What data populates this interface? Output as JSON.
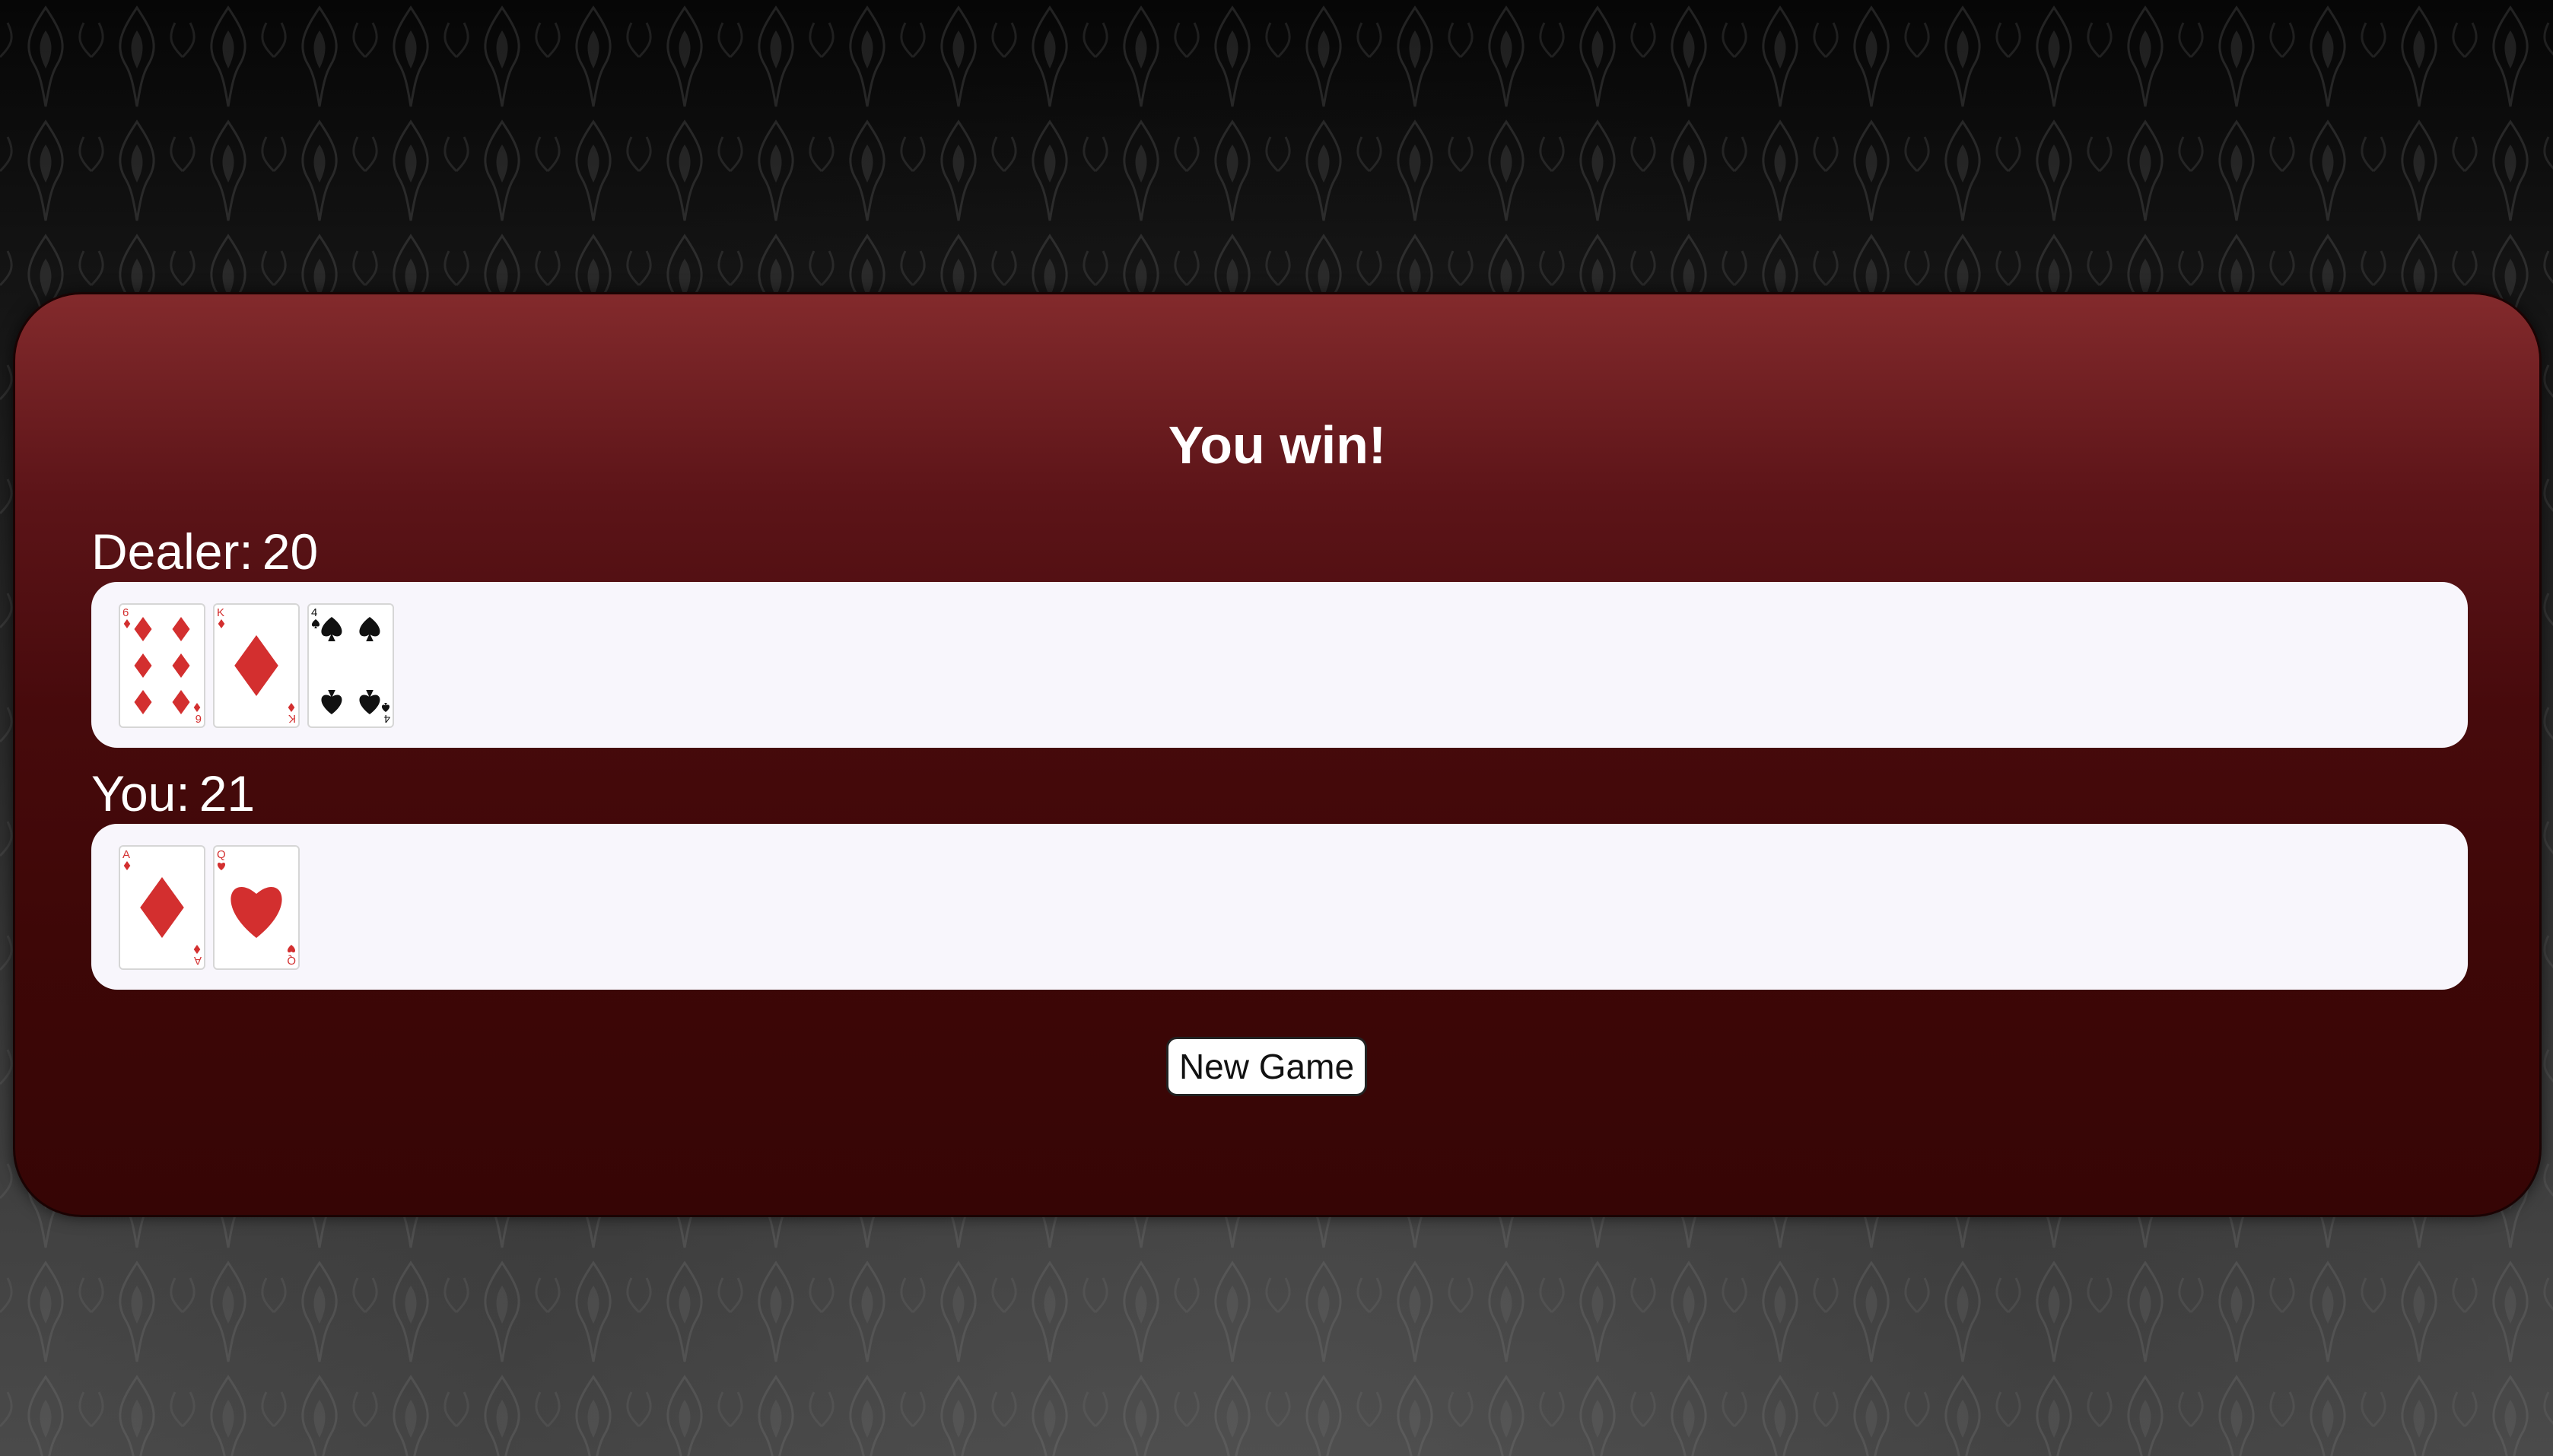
{
  "game": {
    "result": "You win!",
    "new_game_label": "New Game"
  },
  "dealer": {
    "label": "Dealer:",
    "score": "20",
    "cards": [
      {
        "rank": "6",
        "suit": "diamonds"
      },
      {
        "rank": "K",
        "suit": "diamonds"
      },
      {
        "rank": "4",
        "suit": "spades"
      }
    ]
  },
  "player": {
    "label": "You:",
    "score": "21",
    "cards": [
      {
        "rank": "A",
        "suit": "diamonds"
      },
      {
        "rank": "Q",
        "suit": "hearts"
      }
    ]
  },
  "colors": {
    "red_suit": "#d32f2f",
    "black_suit": "#111111",
    "table_top": "#832a2c",
    "table_bottom": "#360505",
    "hand_area": "#f8f6fc"
  }
}
